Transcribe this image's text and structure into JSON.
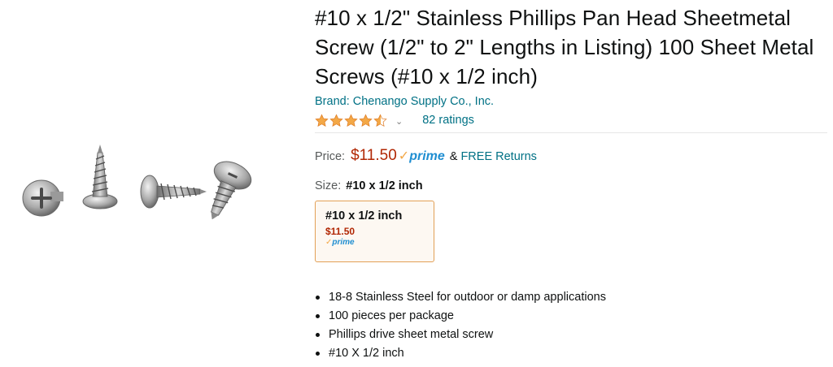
{
  "product": {
    "title": "#10 x 1/2\" Stainless Phillips Pan Head Sheetmetal Screw (1/2\" to 2\" Lengths in Listing) 100 Sheet Metal Screws (#10 x 1/2 inch)",
    "brand": "Brand: Chenango Supply Co., Inc.",
    "rating": {
      "stars": 4.5,
      "count_label": "82 ratings"
    },
    "price": {
      "label": "Price:",
      "value": "$11.50",
      "prime_check": "✓",
      "prime_word": "prime",
      "returns_amp": "&",
      "returns": "FREE Returns"
    },
    "size": {
      "label": "Size:",
      "selected": "#10 x 1/2 inch",
      "options": [
        {
          "name": "#10 x 1/2 inch",
          "price": "$11.50",
          "prime_check": "✓",
          "prime_word": "prime"
        }
      ]
    },
    "bullets": [
      "18-8 Stainless Steel for outdoor or damp applications",
      "100 pieces per package",
      "Phillips drive sheet metal screw",
      "#10 X 1/2 inch"
    ]
  },
  "icons": {
    "star_color": "#f3a847",
    "prime_color": "#1f8ed1"
  }
}
